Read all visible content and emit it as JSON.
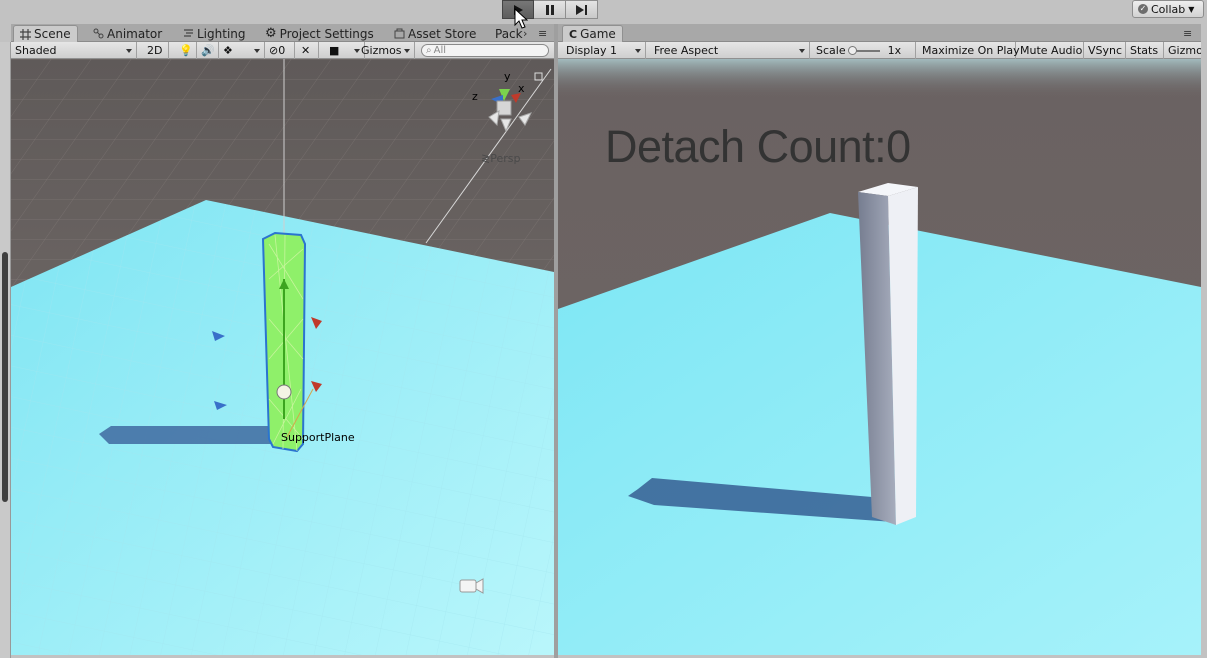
{
  "toolbar_top": {
    "collab_label": "Collab"
  },
  "scene_tabs": [
    {
      "label": "Scene",
      "icon": "grid-icon"
    },
    {
      "label": "Animator",
      "icon": "animator-icon"
    },
    {
      "label": "Lighting",
      "icon": "lighting-icon"
    },
    {
      "label": "Project Settings",
      "icon": "gear-icon"
    },
    {
      "label": "Asset Store",
      "icon": "store-icon"
    },
    {
      "label": "Pack",
      "icon": ""
    }
  ],
  "game_tab": {
    "label": "Game",
    "icon": "game-icon"
  },
  "scene_toolbar": {
    "shading": "Shaded",
    "mode_2d": "2D",
    "hidden_count": "0",
    "gizmos": "Gizmos",
    "search_placeholder": "All"
  },
  "game_toolbar": {
    "display": "Display 1",
    "aspect": "Free Aspect",
    "scale_label": "Scale",
    "scale_value": "1x",
    "maximize": "Maximize On Play",
    "mute": "Mute Audio",
    "vsync": "VSync",
    "stats": "Stats",
    "gizmos": "Gizmo"
  },
  "scene_view": {
    "projection": "Persp",
    "object_label": "SupportPlane",
    "axis_x": "x",
    "axis_y": "y",
    "axis_z": "z"
  },
  "game_view": {
    "overlay_text": "Detach Count:0"
  },
  "colors": {
    "ground": "#8eeaf7",
    "sky": "#6b6363",
    "selection_green": "#8ff06a",
    "pillar": "#e8eaf0"
  }
}
